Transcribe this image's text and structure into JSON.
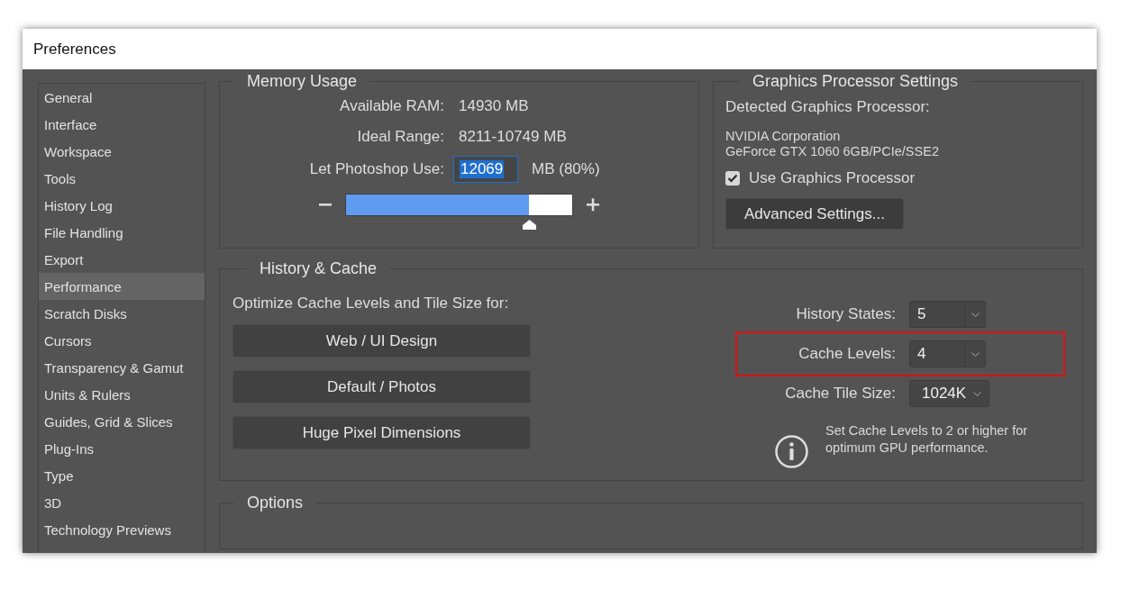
{
  "window": {
    "title": "Preferences"
  },
  "sidebar": {
    "items": [
      {
        "label": "General",
        "selected": false
      },
      {
        "label": "Interface",
        "selected": false
      },
      {
        "label": "Workspace",
        "selected": false
      },
      {
        "label": "Tools",
        "selected": false
      },
      {
        "label": "History Log",
        "selected": false
      },
      {
        "label": "File Handling",
        "selected": false
      },
      {
        "label": "Export",
        "selected": false
      },
      {
        "label": "Performance",
        "selected": true
      },
      {
        "label": "Scratch Disks",
        "selected": false
      },
      {
        "label": "Cursors",
        "selected": false
      },
      {
        "label": "Transparency & Gamut",
        "selected": false
      },
      {
        "label": "Units & Rulers",
        "selected": false
      },
      {
        "label": "Guides, Grid & Slices",
        "selected": false
      },
      {
        "label": "Plug-Ins",
        "selected": false
      },
      {
        "label": "Type",
        "selected": false
      },
      {
        "label": "3D",
        "selected": false
      },
      {
        "label": "Technology Previews",
        "selected": false
      }
    ]
  },
  "memory_usage": {
    "title": "Memory Usage",
    "rows": [
      {
        "label": "Available RAM:",
        "value": "14930 MB"
      },
      {
        "label": "Ideal Range:",
        "value": "8211-10749 MB"
      }
    ],
    "use_label": "Let Photoshop Use:",
    "use_value": "12069",
    "use_suffix": "MB (80%)",
    "slider": {
      "level": 0.81
    }
  },
  "graphics_processor": {
    "title": "Graphics Processor Settings",
    "detected_label": "Detected Graphics Processor:",
    "vendor": "NVIDIA Corporation",
    "model": "GeForce GTX 1060 6GB/PCIe/SSE2",
    "use_gpu": {
      "label": "Use Graphics Processor",
      "checked": true
    },
    "advanced_button": "Advanced Settings..."
  },
  "history_cache": {
    "title": "History & Cache",
    "optimize_label": "Optimize Cache Levels and Tile Size for:",
    "presets": [
      "Web / UI Design",
      "Default / Photos",
      "Huge Pixel Dimensions"
    ],
    "settings": [
      {
        "label": "History States:",
        "value": "5",
        "kind": "spinner",
        "highlighted": false
      },
      {
        "label": "Cache Levels:",
        "value": "4",
        "kind": "spinner",
        "highlighted": true
      },
      {
        "label": "Cache Tile Size:",
        "value": "1024K",
        "kind": "dropdown",
        "highlighted": false
      }
    ],
    "note": "Set Cache Levels to 2 or higher for optimum GPU performance."
  },
  "options": {
    "title": "Options"
  }
}
